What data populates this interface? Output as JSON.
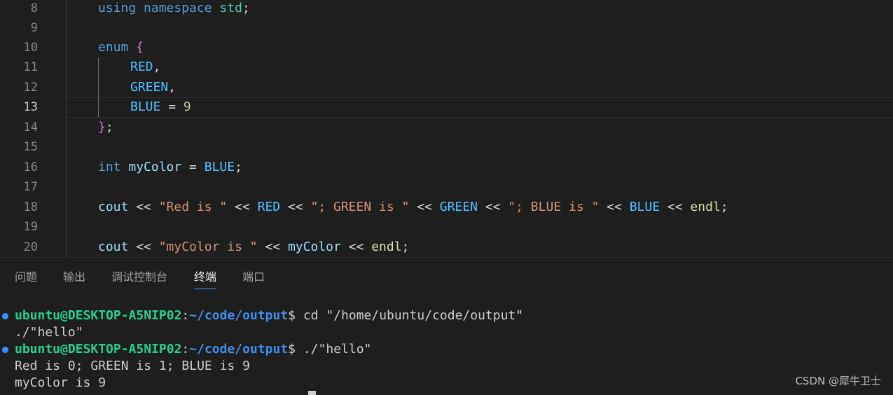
{
  "editor": {
    "line_numbers": [
      "8",
      "9",
      "10",
      "11",
      "12",
      "13",
      "14",
      "15",
      "16",
      "17",
      "18",
      "19",
      "20"
    ],
    "active_line": "13",
    "line8": {
      "t1": "using",
      "t2": "namespace",
      "t3": "std",
      "t4": ";"
    },
    "line10": {
      "t1": "enum",
      "t2": "{"
    },
    "line11": {
      "t1": "RED",
      "t2": ","
    },
    "line12": {
      "t1": "GREEN",
      "t2": ","
    },
    "line13": {
      "t1": "BLUE",
      "t2": " = ",
      "t3": "9"
    },
    "line14": {
      "t1": "}",
      "t2": ";"
    },
    "line16": {
      "t1": "int",
      "t2": "myColor",
      "t3": " = ",
      "t4": "BLUE",
      "t5": ";"
    },
    "line18": {
      "t1": "cout",
      "t2": " << ",
      "t3": "\"Red is \"",
      "t4": " << ",
      "t5": "RED",
      "t6": " << ",
      "t7": "\"; GREEN is \"",
      "t8": " << ",
      "t9": "GREEN",
      "t10": " << ",
      "t11": "\"; BLUE is \"",
      "t12": " << ",
      "t13": "BLUE",
      "t14": " << ",
      "t15": "endl",
      "t16": ";"
    },
    "line20": {
      "t1": "cout",
      "t2": " << ",
      "t3": "\"myColor is \"",
      "t4": " << ",
      "t5": "myColor",
      "t6": " << ",
      "t7": "endl",
      "t8": ";"
    }
  },
  "panel": {
    "tabs": [
      "问题",
      "输出",
      "调试控制台",
      "终端",
      "端口"
    ],
    "active_tab": "终端"
  },
  "terminal": {
    "prompt_user": "ubuntu@DESKTOP-A5NIP02",
    "prompt_sep": ":",
    "prompt_path": "~/code/output",
    "prompt_symbol": "$",
    "cmd1": " cd \"/home/ubuntu/code/output\"",
    "cmd1_cont": "./\"hello\"",
    "cmd2": " ./\"hello\"",
    "output1": "Red is 0; GREEN is 1; BLUE is 9",
    "output2": "myColor is 9"
  },
  "watermark": "CSDN @犀牛卫士",
  "colors": {
    "background": "#1e1e1e",
    "keyword": "#569cd6",
    "enum_member": "#4fc1ff",
    "string": "#ce9178",
    "number": "#b5cea8",
    "function": "#dcdcaa",
    "namespace": "#4ec9b0",
    "prompt_user": "#23d18b",
    "prompt_path": "#3b8eea",
    "accent": "#3794ff"
  }
}
